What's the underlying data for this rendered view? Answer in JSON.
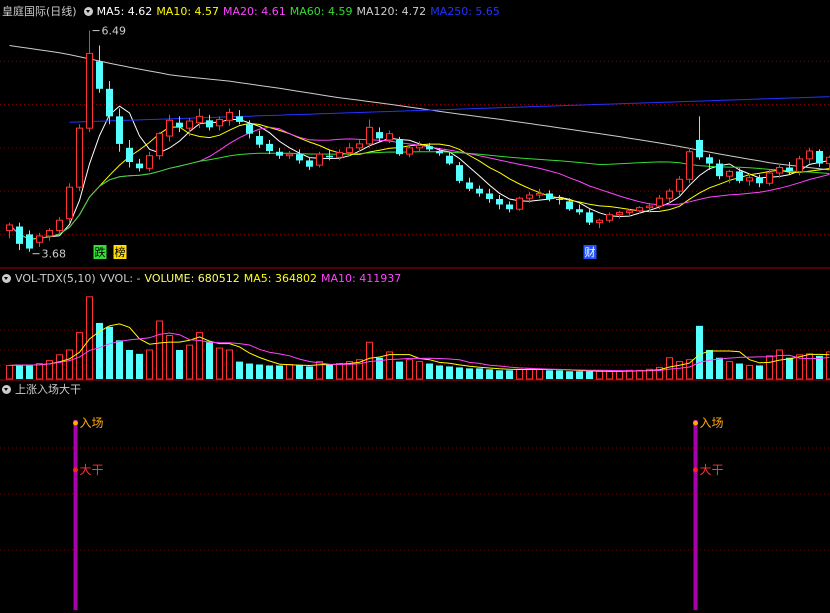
{
  "main_legend": {
    "title": "皇庭国际(日线)",
    "ma": [
      {
        "label": "MA5: 4.62",
        "color": "#ffffff"
      },
      {
        "label": "MA10: 4.57",
        "color": "#ffff00"
      },
      {
        "label": "MA20: 4.61",
        "color": "#ff44ff"
      },
      {
        "label": "MA60: 4.59",
        "color": "#33dd33"
      },
      {
        "label": "MA120: 4.72",
        "color": "#cccccc"
      },
      {
        "label": "MA250: 5.65",
        "color": "#2233ff"
      }
    ]
  },
  "vol_legend": {
    "title": "VOL-TDX(5,10)",
    "vvol": "VVOL: -",
    "volume": "VOLUME: 680512",
    "ma5": "MA5: 364802",
    "ma10": "MA10: 411937",
    "colors": {
      "volume": "#ffff66",
      "ma5": "#ffff00",
      "ma10": "#ff44ff"
    }
  },
  "signal_legend": {
    "title": "上涨入场大干"
  },
  "colors": {
    "up": "#ff3333",
    "down": "#55ffff",
    "grid": "#880000",
    "signal_bar": "#aa00aa",
    "signal_dot_in": "#ffaa00",
    "signal_dot_gan": "#ff2222",
    "label_text_in": "#ffaa00",
    "label_text_gan": "#ff3333",
    "marker_die": "#33dd33",
    "marker_cai": "#ffffff",
    "marker_cai_bg": "#2255ff"
  },
  "chart_data": {
    "type": "candlestick",
    "count": 83,
    "price_range": [
      3.6,
      6.65
    ],
    "high_annotation": {
      "label": "6.49",
      "index": 8,
      "value": 6.49
    },
    "low_annotation": {
      "label": "3.68",
      "index": 2,
      "value": 3.68
    },
    "markers": [
      {
        "label": "跌",
        "index": 9,
        "style": "green"
      },
      {
        "label": "榜",
        "index": 11,
        "style": "yellow"
      },
      {
        "label": "财",
        "index": 58,
        "style": "blue"
      }
    ],
    "ohlc": [
      [
        3.95,
        4.05,
        3.85,
        4.02
      ],
      [
        4.0,
        4.05,
        3.7,
        3.78
      ],
      [
        3.9,
        3.95,
        3.68,
        3.72
      ],
      [
        3.8,
        3.92,
        3.74,
        3.88
      ],
      [
        3.88,
        3.98,
        3.82,
        3.95
      ],
      [
        3.95,
        4.12,
        3.92,
        4.08
      ],
      [
        4.1,
        4.55,
        4.05,
        4.5
      ],
      [
        4.5,
        5.3,
        4.45,
        5.25
      ],
      [
        5.25,
        6.49,
        5.2,
        6.2
      ],
      [
        6.1,
        6.3,
        5.7,
        5.75
      ],
      [
        5.75,
        5.85,
        5.3,
        5.4
      ],
      [
        5.4,
        5.5,
        4.95,
        5.05
      ],
      [
        5.0,
        5.1,
        4.75,
        4.82
      ],
      [
        4.8,
        4.86,
        4.7,
        4.74
      ],
      [
        4.74,
        4.95,
        4.7,
        4.9
      ],
      [
        4.9,
        5.2,
        4.85,
        5.18
      ],
      [
        5.15,
        5.42,
        5.08,
        5.35
      ],
      [
        5.32,
        5.4,
        5.2,
        5.26
      ],
      [
        5.25,
        5.38,
        5.15,
        5.34
      ],
      [
        5.32,
        5.5,
        5.25,
        5.4
      ],
      [
        5.35,
        5.42,
        5.22,
        5.26
      ],
      [
        5.28,
        5.4,
        5.22,
        5.36
      ],
      [
        5.35,
        5.5,
        5.28,
        5.45
      ],
      [
        5.4,
        5.48,
        5.3,
        5.33
      ],
      [
        5.3,
        5.35,
        5.12,
        5.18
      ],
      [
        5.15,
        5.22,
        5.0,
        5.04
      ],
      [
        5.05,
        5.1,
        4.92,
        4.96
      ],
      [
        4.95,
        5.0,
        4.86,
        4.9
      ],
      [
        4.9,
        4.96,
        4.86,
        4.92
      ],
      [
        4.92,
        4.98,
        4.8,
        4.84
      ],
      [
        4.84,
        4.88,
        4.72,
        4.76
      ],
      [
        4.78,
        4.95,
        4.75,
        4.92
      ],
      [
        4.9,
        4.98,
        4.84,
        4.88
      ],
      [
        4.88,
        4.98,
        4.84,
        4.94
      ],
      [
        4.94,
        5.06,
        4.9,
        5.0
      ],
      [
        5.0,
        5.1,
        4.95,
        5.05
      ],
      [
        5.05,
        5.36,
        5.0,
        5.26
      ],
      [
        5.2,
        5.26,
        5.08,
        5.12
      ],
      [
        5.1,
        5.22,
        5.06,
        5.18
      ],
      [
        5.1,
        5.14,
        4.9,
        4.92
      ],
      [
        4.92,
        5.04,
        4.88,
        5.0
      ],
      [
        5.0,
        5.08,
        4.95,
        5.03
      ],
      [
        5.02,
        5.06,
        4.96,
        4.98
      ],
      [
        4.96,
        5.0,
        4.9,
        4.93
      ],
      [
        4.9,
        4.95,
        4.78,
        4.8
      ],
      [
        4.78,
        4.82,
        4.55,
        4.58
      ],
      [
        4.56,
        4.62,
        4.45,
        4.48
      ],
      [
        4.48,
        4.52,
        4.38,
        4.42
      ],
      [
        4.42,
        4.48,
        4.3,
        4.35
      ],
      [
        4.35,
        4.4,
        4.22,
        4.28
      ],
      [
        4.28,
        4.32,
        4.18,
        4.22
      ],
      [
        4.22,
        4.38,
        4.2,
        4.36
      ],
      [
        4.36,
        4.44,
        4.3,
        4.4
      ],
      [
        4.4,
        4.48,
        4.36,
        4.42
      ],
      [
        4.42,
        4.46,
        4.32,
        4.35
      ],
      [
        4.35,
        4.4,
        4.28,
        4.34
      ],
      [
        4.32,
        4.36,
        4.2,
        4.22
      ],
      [
        4.22,
        4.28,
        4.15,
        4.18
      ],
      [
        4.18,
        4.22,
        4.02,
        4.05
      ],
      [
        4.05,
        4.1,
        3.98,
        4.08
      ],
      [
        4.08,
        4.18,
        4.05,
        4.15
      ],
      [
        4.15,
        4.2,
        4.1,
        4.18
      ],
      [
        4.18,
        4.22,
        4.12,
        4.2
      ],
      [
        4.2,
        4.26,
        4.16,
        4.24
      ],
      [
        4.24,
        4.3,
        4.18,
        4.26
      ],
      [
        4.26,
        4.4,
        4.22,
        4.36
      ],
      [
        4.36,
        4.48,
        4.3,
        4.45
      ],
      [
        4.45,
        4.64,
        4.4,
        4.6
      ],
      [
        4.6,
        5.0,
        4.55,
        4.95
      ],
      [
        5.1,
        5.4,
        4.85,
        4.88
      ],
      [
        4.88,
        4.92,
        4.72,
        4.8
      ],
      [
        4.8,
        4.85,
        4.6,
        4.64
      ],
      [
        4.64,
        4.72,
        4.55,
        4.7
      ],
      [
        4.7,
        4.74,
        4.55,
        4.58
      ],
      [
        4.58,
        4.68,
        4.52,
        4.62
      ],
      [
        4.62,
        4.66,
        4.5,
        4.55
      ],
      [
        4.55,
        4.72,
        4.52,
        4.68
      ],
      [
        4.68,
        4.8,
        4.62,
        4.75
      ],
      [
        4.75,
        4.82,
        4.66,
        4.7
      ],
      [
        4.7,
        4.9,
        4.65,
        4.86
      ],
      [
        4.86,
        5.0,
        4.8,
        4.96
      ],
      [
        4.96,
        4.98,
        4.76,
        4.8
      ],
      [
        4.8,
        4.9,
        4.72,
        4.88
      ]
    ],
    "ma250_start": 5.3,
    "ma250_end": 5.65,
    "ma120_series": [
      6.3,
      6.2,
      6.05,
      5.92,
      5.85,
      5.75,
      5.64,
      5.55,
      5.45,
      5.36,
      5.26,
      5.16,
      5.05,
      4.92,
      4.8,
      4.72
    ],
    "volume": [
      14,
      15,
      14,
      16,
      19,
      25,
      30,
      48,
      85,
      58,
      54,
      40,
      30,
      26,
      30,
      60,
      45,
      30,
      35,
      48,
      38,
      32,
      30,
      18,
      16,
      15,
      14,
      14,
      15,
      14,
      13,
      18,
      15,
      16,
      18,
      20,
      38,
      22,
      28,
      18,
      20,
      18,
      16,
      14,
      13,
      12,
      11,
      11,
      10,
      9,
      9,
      10,
      11,
      10,
      9,
      9,
      8,
      8,
      8,
      8,
      8,
      8,
      9,
      9,
      10,
      12,
      22,
      18,
      20,
      55,
      30,
      22,
      18,
      16,
      14,
      14,
      24,
      30,
      22,
      25,
      26,
      24,
      28
    ],
    "volume_max": 90,
    "signals": [
      {
        "index": 7,
        "entry_label": "入场",
        "action_label": "大干"
      },
      {
        "index": 69,
        "entry_label": "入场",
        "action_label": "大干"
      }
    ]
  }
}
